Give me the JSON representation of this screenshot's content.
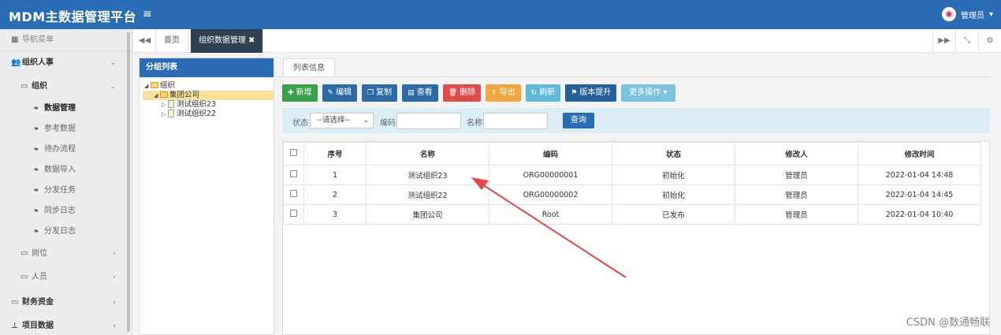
{
  "app": {
    "title": "MDM主数据管理平台",
    "user": "管理员"
  },
  "sidebar": {
    "header": "导航菜单",
    "group1": "组织人事",
    "group1_sub": "组织",
    "items": [
      "数据管理",
      "参考数据",
      "待办流程",
      "数据导入",
      "分发任务",
      "同步日志",
      "分发日志"
    ],
    "sub2": "岗位",
    "sub3": "人员",
    "group2": "财务资金",
    "group3": "项目数据"
  },
  "tabs": {
    "home": "首页",
    "active": "组织数据管理"
  },
  "tree": {
    "title": "分组列表",
    "root": "组织",
    "company": "集团公司",
    "child1": "测试组织23",
    "child2": "测试组织22"
  },
  "main": {
    "subtab": "列表信息",
    "toolbar": {
      "add": "新增",
      "edit": "编辑",
      "copy": "复制",
      "view": "查看",
      "delete": "删除",
      "export": "导出",
      "refresh": "刷新",
      "upgrade": "版本提升",
      "more": "更多操作"
    },
    "search": {
      "status_label": "状态",
      "status_value": "--请选择--",
      "code_label": "编码",
      "name_label": "名称",
      "button": "查询"
    },
    "columns": [
      "序号",
      "名称",
      "编码",
      "状态",
      "修改人",
      "修改时间"
    ],
    "rows": [
      [
        "1",
        "测试组织23",
        "ORG00000001",
        "初始化",
        "管理员",
        "2022-01-04 14:48"
      ],
      [
        "2",
        "测试组织22",
        "ORG00000002",
        "初始化",
        "管理员",
        "2022-01-04 14:45"
      ],
      [
        "3",
        "集团公司",
        "Root",
        "已发布",
        "管理员",
        "2022-01-04 10:40"
      ]
    ]
  },
  "watermark": "CSDN @数通畅联",
  "colors": {
    "primary": "#2a6db6",
    "annotation_arrow": "#e04848"
  }
}
